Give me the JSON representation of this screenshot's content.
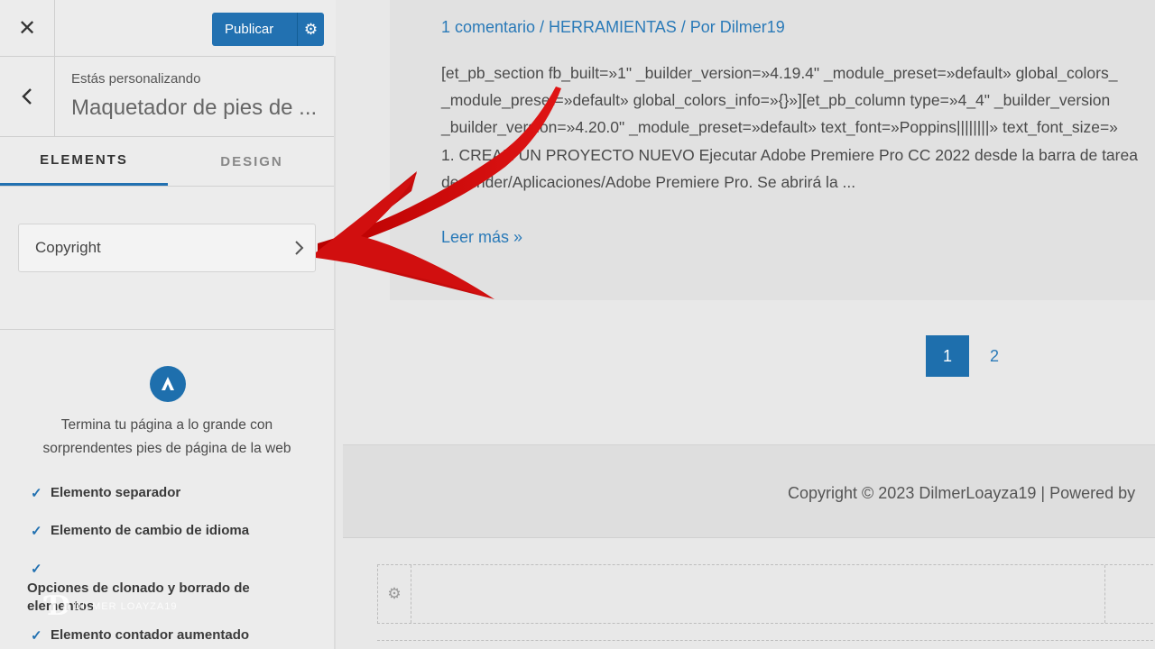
{
  "sidebar": {
    "close_icon": "close-icon",
    "publish_label": "Publicar",
    "customizing_label": "Estás personalizando",
    "section_title": "Maquetador de pies de ...",
    "tabs": [
      {
        "label": "ELEMENTS",
        "active": true
      },
      {
        "label": "DESIGN",
        "active": false
      }
    ],
    "items": [
      {
        "label": "Copyright"
      }
    ],
    "promo": {
      "text": "Termina tu página a lo grande con sorprendentes pies de página de la web",
      "features": [
        "Elemento separador",
        "Elemento de cambio de idioma",
        "Opciones de clonado y borrado de elementos",
        "Elemento contador aumentado"
      ]
    },
    "watermark": "DILMER LOAYZA19"
  },
  "preview": {
    "post_meta": "1 comentario / HERRAMIENTAS / Por Dilmer19",
    "excerpt": [
      "[et_pb_section fb_built=»1\" _builder_version=»4.19.4\" _module_preset=»default» global_colors_",
      "_module_preset=»default» global_colors_info=»{}»][et_pb_column type=»4_4\" _builder_version",
      "_builder_version=»4.20.0\" _module_preset=»default» text_font=»Poppins||||||||» text_font_size=»",
      "1. CREAR UN PROYECTO NUEVO  Ejecutar Adobe Premiere Pro CC 2022 desde la barra de tarea",
      "de Finder/Aplicaciones/Adobe Premiere Pro. Se abrirá la ..."
    ],
    "read_more": "Leer más »",
    "pagination": [
      "1",
      "2"
    ],
    "current_page": "1",
    "footer_text": "Copyright © 2023 DilmerLoayza19 | Powered by"
  },
  "colors": {
    "accent": "#2271b1",
    "link": "#2a7ab8",
    "arrow": "#d10f0f"
  }
}
